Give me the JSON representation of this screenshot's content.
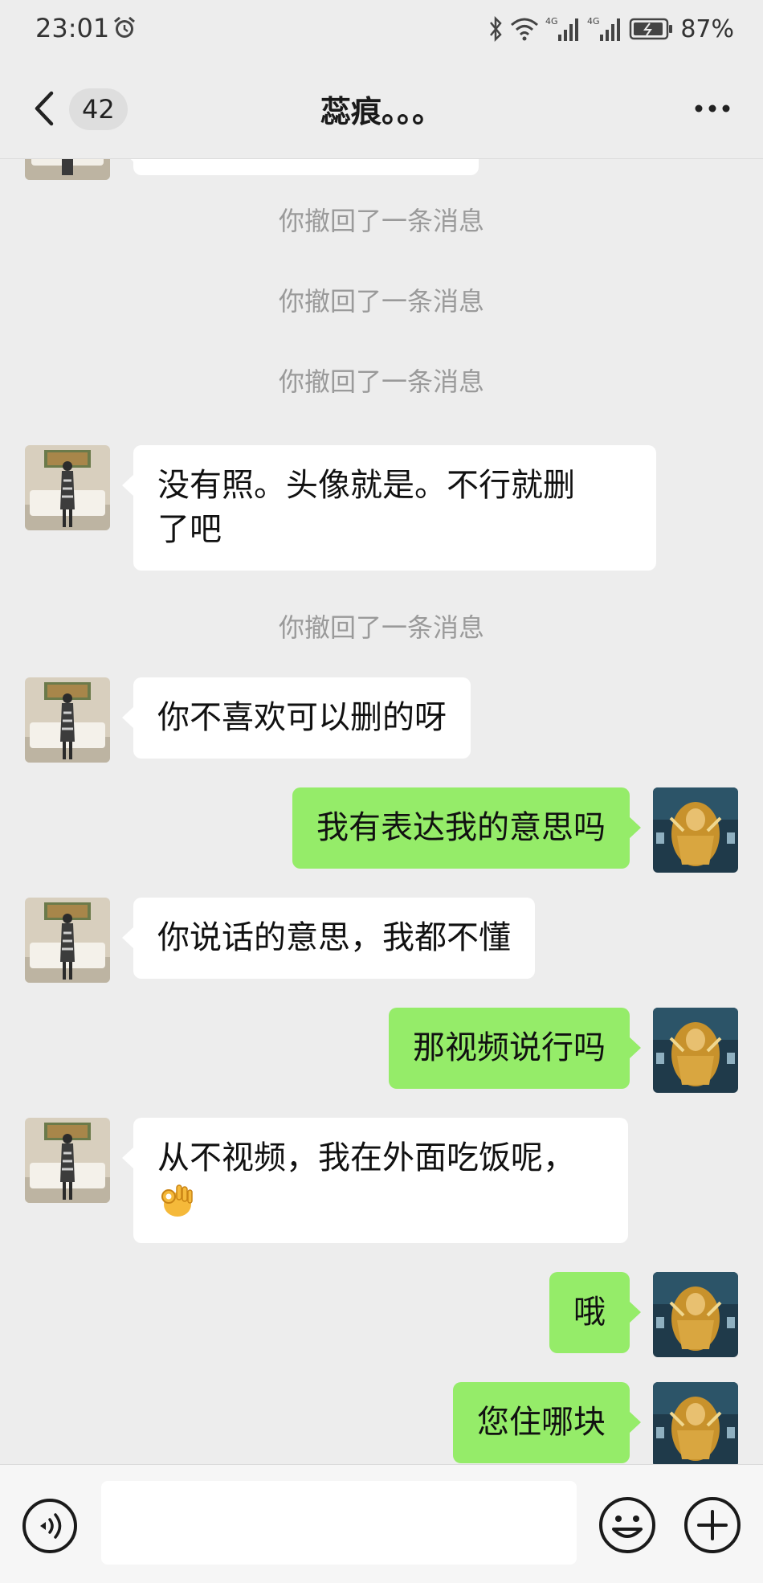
{
  "status_bar": {
    "time": "23:01",
    "battery": "87%",
    "icons": [
      "alarm-icon",
      "bluetooth-icon",
      "wifi-icon",
      "signal-4g-icon",
      "signal-4g-icon",
      "battery-icon"
    ]
  },
  "header": {
    "unread_count": "42",
    "title": "蕊痕。。。",
    "icons": [
      "back-arrow-icon",
      "more-icon"
    ]
  },
  "messages": [
    {
      "type": "incoming",
      "text": ""
    },
    {
      "type": "recall",
      "text": "你撤回了一条消息"
    },
    {
      "type": "recall",
      "text": "你撤回了一条消息"
    },
    {
      "type": "recall",
      "text": "你撤回了一条消息"
    },
    {
      "type": "incoming",
      "text_line1": "没有照。头像就是。不行就删",
      "text_line2": "了吧"
    },
    {
      "type": "recall",
      "text": "你撤回了一条消息"
    },
    {
      "type": "incoming",
      "text": "你不喜欢可以删的呀"
    },
    {
      "type": "outgoing",
      "text": "我有表达我的意思吗"
    },
    {
      "type": "incoming",
      "text": "你说话的意思，我都不懂"
    },
    {
      "type": "outgoing",
      "text": "那视频说行吗"
    },
    {
      "type": "incoming",
      "text": "从不视频，我在外面吃饭呢，",
      "emoji": "ok-hand-emoji"
    },
    {
      "type": "outgoing",
      "text": "哦"
    },
    {
      "type": "outgoing",
      "text": "您住哪块"
    }
  ],
  "input_bar": {
    "value": "",
    "icons": [
      "voice-icon",
      "emoji-icon",
      "plus-icon"
    ]
  },
  "colors": {
    "background": "#ededed",
    "incoming_bubble": "#ffffff",
    "outgoing_bubble": "#95ec69",
    "system_text": "#9a9a9a"
  }
}
